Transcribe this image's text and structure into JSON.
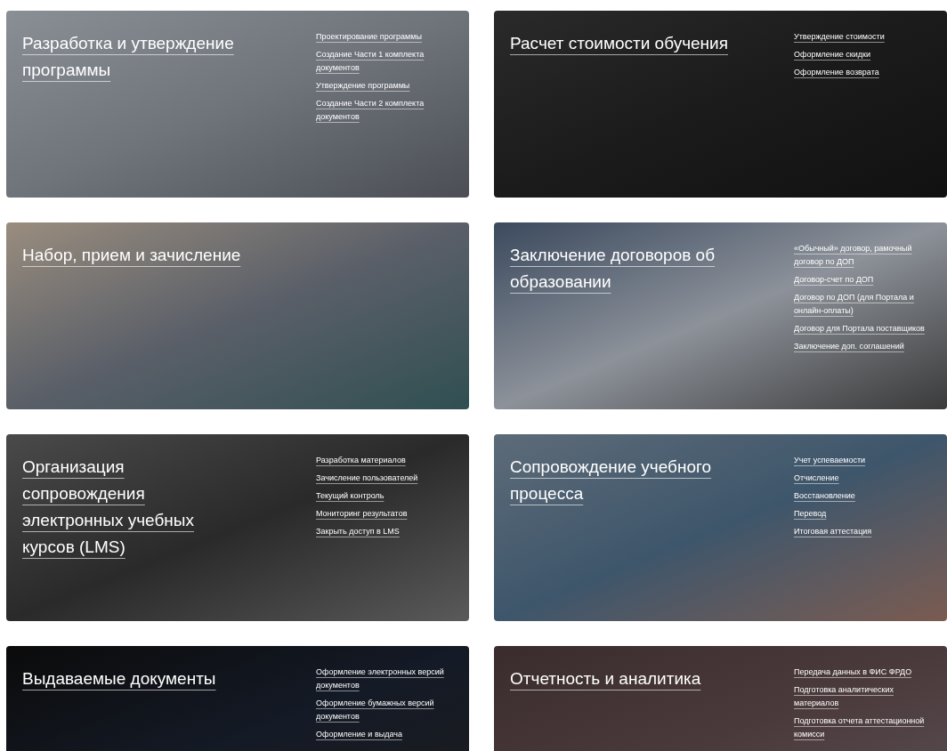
{
  "cards": [
    {
      "title": "Разработка и утверждение программы",
      "links": [
        "Проектирование программы",
        "Создание Части 1 комплекта документов",
        "Утверждение программы",
        "Создание Части 2 комплекта документов"
      ]
    },
    {
      "title": "Расчет стоимости обучения",
      "links": [
        "Утверждение стоимости",
        "Оформление скидки",
        "Оформление возврата"
      ]
    },
    {
      "title": "Набор, прием и зачисление"
    },
    {
      "title": "Заключение договоров об образовании",
      "links": [
        "«Обычный» договор, рамочный договор по ДОП",
        "Договор-счет по ДОП",
        "Договор по ДОП (для Портала и онлайн-оплаты)",
        "Договор для Портала поставщиков",
        "Заключение доп. соглашений"
      ]
    },
    {
      "title": "Организация сопровождения электронных учебных курсов (LMS)",
      "links": [
        "Разработка материалов",
        "Зачисление пользователей",
        "Текущий контроль",
        "Мониторинг результатов",
        "Закрыть доступ в LMS"
      ]
    },
    {
      "title": "Сопровождение учебного процесса",
      "links": [
        "Учет успеваемости",
        "Отчисление",
        "Восстановление",
        "Перевод",
        "Итоговая аттестация"
      ]
    },
    {
      "title": "Выдаваемые документы",
      "links": [
        "Оформление электронных версий документов",
        "Оформление бумажных версий документов",
        "Оформление и выдача"
      ]
    },
    {
      "title": "Отчетность и аналитика",
      "links": [
        "Передача данных в ФИС ФРДО",
        "Подготовка аналитических материалов",
        "Подготовка отчета аттестационной комисси"
      ]
    }
  ]
}
